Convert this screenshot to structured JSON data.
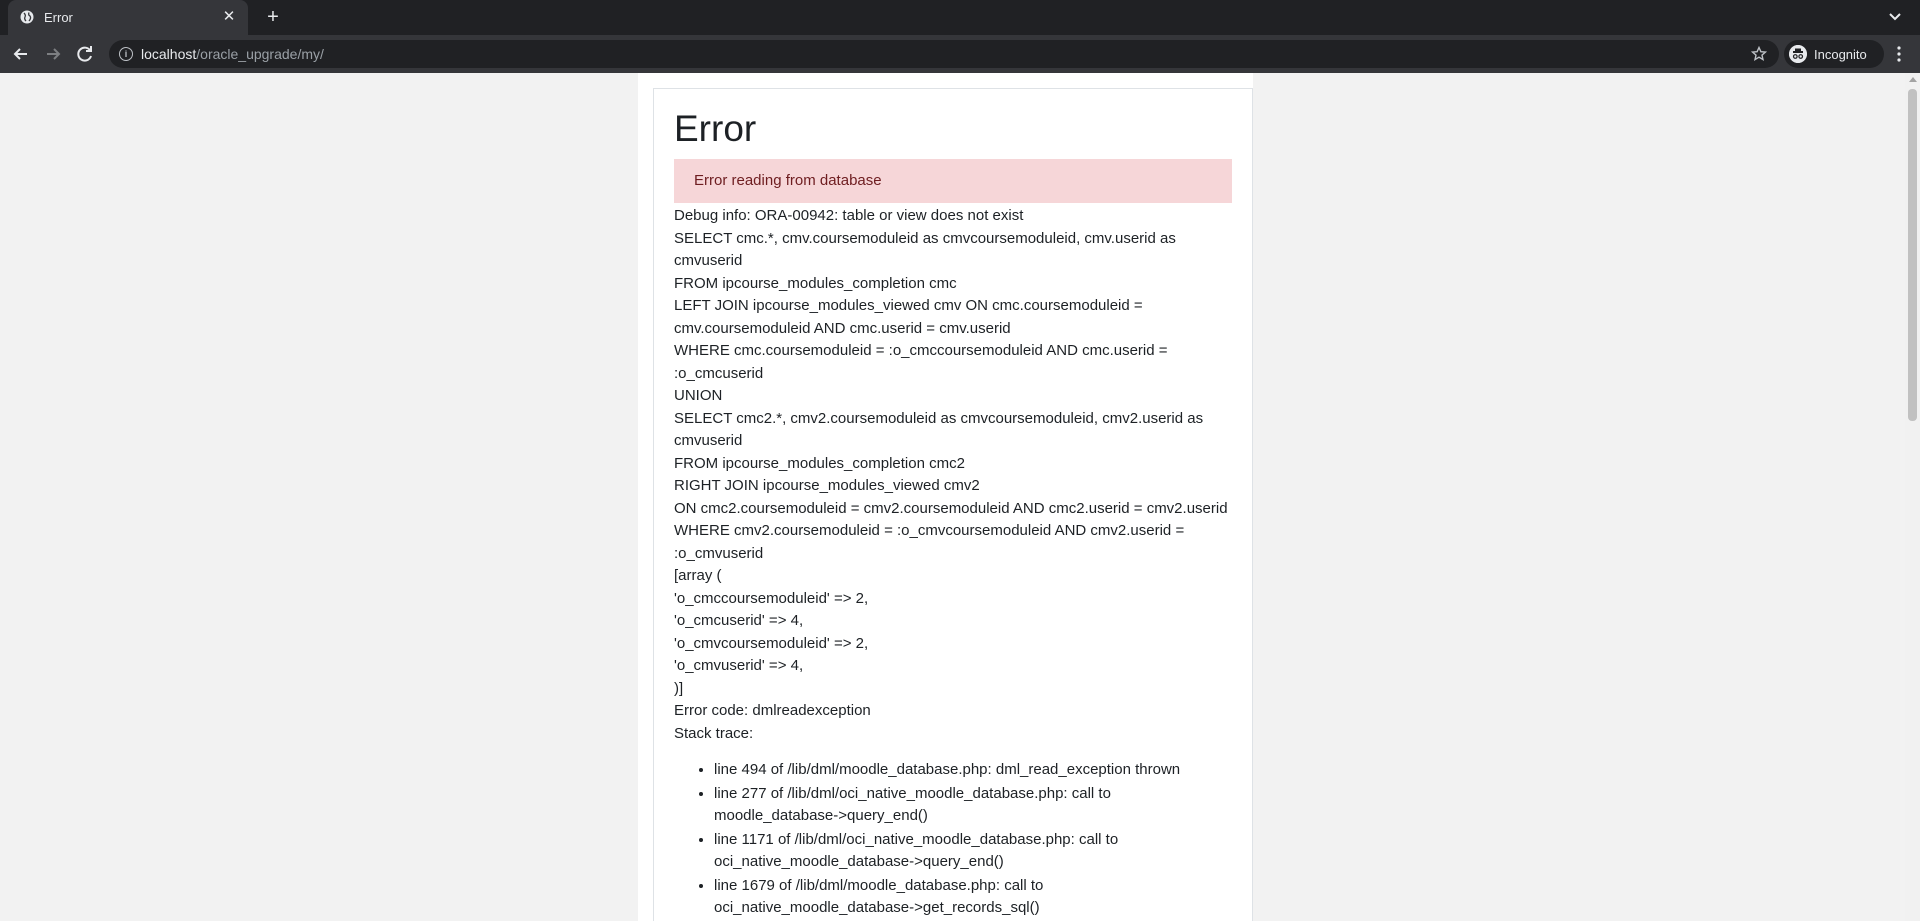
{
  "browser": {
    "tab_title": "Error",
    "new_tab": "+",
    "url_host": "localhost",
    "url_path": "/oracle_upgrade/my/",
    "profile_label": "Incognito"
  },
  "page": {
    "title": "Error",
    "alert": "Error reading from database",
    "debug_lines": [
      "Debug info: ORA-00942: table or view does not exist",
      "SELECT cmc.*, cmv.coursemoduleid as cmvcoursemoduleid, cmv.userid as cmvuserid",
      "FROM ipcourse_modules_completion cmc",
      "LEFT JOIN ipcourse_modules_viewed cmv ON cmc.coursemoduleid = cmv.coursemoduleid AND cmc.userid = cmv.userid",
      "WHERE cmc.coursemoduleid = :o_cmccoursemoduleid AND cmc.userid = :o_cmcuserid",
      "UNION",
      "SELECT cmc2.*, cmv2.coursemoduleid as cmvcoursemoduleid, cmv2.userid as cmvuserid",
      "FROM ipcourse_modules_completion cmc2",
      "RIGHT JOIN ipcourse_modules_viewed cmv2",
      "ON cmc2.coursemoduleid = cmv2.coursemoduleid AND cmc2.userid = cmv2.userid",
      "WHERE cmv2.coursemoduleid = :o_cmvcoursemoduleid AND cmv2.userid = :o_cmvuserid",
      "[array (",
      "'o_cmccoursemoduleid' => 2,",
      "'o_cmcuserid' => 4,",
      "'o_cmvcoursemoduleid' => 2,",
      "'o_cmvuserid' => 4,",
      ")]",
      "Error code: dmlreadexception",
      "Stack trace:"
    ],
    "stack_trace": [
      "line 494 of /lib/dml/moodle_database.php: dml_read_exception thrown",
      "line 277 of /lib/dml/oci_native_moodle_database.php: call to moodle_database->query_end()",
      "line 1171 of /lib/dml/oci_native_moodle_database.php: call to oci_native_moodle_database->query_end()",
      "line 1679 of /lib/dml/moodle_database.php: call to oci_native_moodle_database->get_records_sql()"
    ]
  },
  "icons": [
    "globe-icon",
    "close-icon",
    "back-arrow-icon",
    "forward-arrow-icon",
    "reload-icon",
    "info-icon",
    "star-icon",
    "incognito-icon",
    "kebab-menu-icon",
    "chevron-down-icon"
  ]
}
